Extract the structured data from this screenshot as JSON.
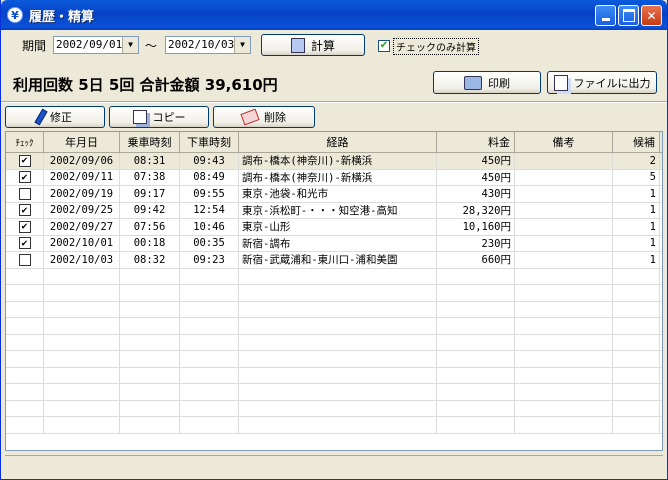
{
  "window": {
    "title": "履歴・精算"
  },
  "filter": {
    "period_label": "期間",
    "date_from": "2002/09/01",
    "tilde": "〜",
    "date_to": "2002/10/03",
    "calc_button": "計算",
    "check_only_label": "チェックのみ計算",
    "check_only_checked": true
  },
  "summary": {
    "text": "利用回数 5日 5回  合計金額 39,610円"
  },
  "toolbar": {
    "print_button": "印刷",
    "export_button": "ファイルに出力",
    "edit_button": "修正",
    "copy_button": "コピー",
    "delete_button": "削除"
  },
  "table": {
    "headers": [
      "ﾁｪｯｸ",
      "年月日",
      "乗車時刻",
      "下車時刻",
      "経路",
      "料金",
      "備考",
      "候補"
    ],
    "rows": [
      {
        "checked": true,
        "date": "2002/09/06",
        "on": "08:31",
        "off": "09:43",
        "route": "調布-橋本(神奈川)-新横浜",
        "fare": "450円",
        "note": "",
        "cand": "2"
      },
      {
        "checked": true,
        "date": "2002/09/11",
        "on": "07:38",
        "off": "08:49",
        "route": "調布-橋本(神奈川)-新横浜",
        "fare": "450円",
        "note": "",
        "cand": "5"
      },
      {
        "checked": false,
        "date": "2002/09/19",
        "on": "09:17",
        "off": "09:55",
        "route": "東京-池袋-和光市",
        "fare": "430円",
        "note": "",
        "cand": "1"
      },
      {
        "checked": true,
        "date": "2002/09/25",
        "on": "09:42",
        "off": "12:54",
        "route": "東京-浜松町-・・・知空港-高知",
        "fare": "28,320円",
        "note": "",
        "cand": "1"
      },
      {
        "checked": true,
        "date": "2002/09/27",
        "on": "07:56",
        "off": "10:46",
        "route": "東京-山形",
        "fare": "10,160円",
        "note": "",
        "cand": "1"
      },
      {
        "checked": true,
        "date": "2002/10/01",
        "on": "00:18",
        "off": "00:35",
        "route": "新宿-調布",
        "fare": "230円",
        "note": "",
        "cand": "1"
      },
      {
        "checked": false,
        "date": "2002/10/03",
        "on": "08:32",
        "off": "09:23",
        "route": "新宿-武蔵浦和-東川口-浦和美園",
        "fare": "660円",
        "note": "",
        "cand": "1"
      }
    ]
  },
  "icons": {
    "app": "yen-icon"
  }
}
